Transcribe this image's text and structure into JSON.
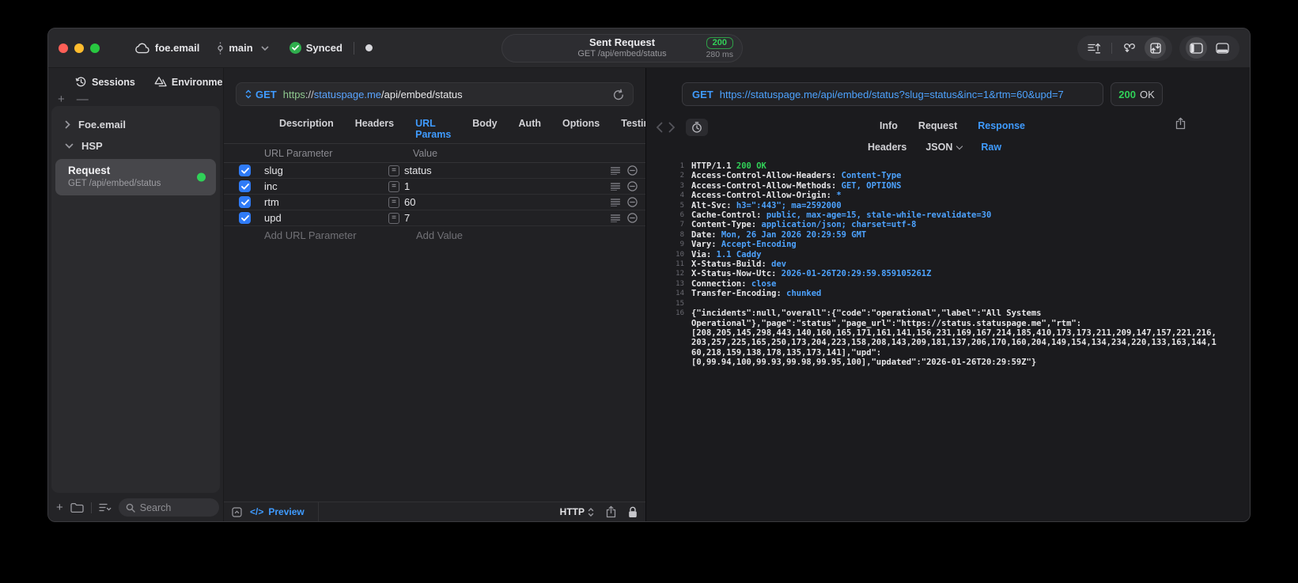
{
  "titlebar": {
    "project": "foe.email",
    "branch": "main",
    "sync_label": "Synced",
    "request_summary": {
      "title": "Sent Request",
      "subtitle": "GET /api/embed/status",
      "status_code": "200",
      "duration": "280 ms"
    }
  },
  "sidebar": {
    "tabs": [
      {
        "label": "Sessions"
      },
      {
        "label": "Environments"
      }
    ],
    "tree": {
      "group1": "Foe.email",
      "group2": "HSP"
    },
    "request_item": {
      "title": "Request",
      "subtitle": "GET /api/embed/status"
    },
    "search_placeholder": "Search"
  },
  "request_editor": {
    "method": "GET",
    "url": {
      "scheme": "https",
      "separator": "://",
      "host": "statuspage.me",
      "path": "/api/embed/status"
    },
    "tabs": [
      {
        "label": "Description",
        "active": false
      },
      {
        "label": "Headers",
        "active": false
      },
      {
        "label": "URL Params",
        "active": true
      },
      {
        "label": "Body",
        "active": false
      },
      {
        "label": "Auth",
        "active": false
      },
      {
        "label": "Options",
        "active": false
      },
      {
        "label": "Testing",
        "active": false
      }
    ],
    "params": {
      "columns": [
        "URL Parameter",
        "Value"
      ],
      "rows": [
        {
          "name": "slug",
          "value": "status",
          "enabled": true
        },
        {
          "name": "inc",
          "value": "1",
          "enabled": true
        },
        {
          "name": "rtm",
          "value": "60",
          "enabled": true
        },
        {
          "name": "upd",
          "value": "7",
          "enabled": true
        }
      ],
      "add_name": "Add URL Parameter",
      "add_value": "Add Value"
    },
    "footer": {
      "code_glyph": "</>",
      "preview": "Preview",
      "protocol": "HTTP"
    }
  },
  "response_viewer": {
    "method": "GET",
    "url": "https://statuspage.me/api/embed/status?slug=status&inc=1&rtm=60&upd=7",
    "status_code": "200",
    "status_text": "OK",
    "tabs": [
      {
        "label": "Info",
        "active": false
      },
      {
        "label": "Request",
        "active": false
      },
      {
        "label": "Response",
        "active": true
      }
    ],
    "subtabs": [
      {
        "label": "Headers",
        "active": false
      },
      {
        "label": "JSON",
        "active": false,
        "chevron": true
      },
      {
        "label": "Raw",
        "active": true
      }
    ],
    "lines": [
      {
        "n": "1",
        "segs": [
          {
            "t": "HTTP/1.1 ",
            "c": "plain"
          },
          {
            "t": "200 OK",
            "c": "green"
          }
        ]
      },
      {
        "n": "2",
        "segs": [
          {
            "t": "Access-Control-Allow-Headers:",
            "c": "key"
          },
          {
            "t": " Content-Type",
            "c": "val"
          }
        ]
      },
      {
        "n": "3",
        "segs": [
          {
            "t": "Access-Control-Allow-Methods:",
            "c": "key"
          },
          {
            "t": " GET, OPTIONS",
            "c": "val"
          }
        ]
      },
      {
        "n": "4",
        "segs": [
          {
            "t": "Access-Control-Allow-Origin:",
            "c": "key"
          },
          {
            "t": " *",
            "c": "val"
          }
        ]
      },
      {
        "n": "5",
        "segs": [
          {
            "t": "Alt-Svc:",
            "c": "key"
          },
          {
            "t": " h3=\":443\"; ma=2592000",
            "c": "val"
          }
        ]
      },
      {
        "n": "6",
        "segs": [
          {
            "t": "Cache-Control:",
            "c": "key"
          },
          {
            "t": " public, max-age=15, stale-while-revalidate=30",
            "c": "val"
          }
        ]
      },
      {
        "n": "7",
        "segs": [
          {
            "t": "Content-Type:",
            "c": "key"
          },
          {
            "t": " application/json; charset=utf-8",
            "c": "val"
          }
        ]
      },
      {
        "n": "8",
        "segs": [
          {
            "t": "Date:",
            "c": "key"
          },
          {
            "t": " Mon, 26 Jan 2026 20:29:59 GMT",
            "c": "val"
          }
        ]
      },
      {
        "n": "9",
        "segs": [
          {
            "t": "Vary:",
            "c": "key"
          },
          {
            "t": " Accept-Encoding",
            "c": "val"
          }
        ]
      },
      {
        "n": "10",
        "segs": [
          {
            "t": "Via:",
            "c": "key"
          },
          {
            "t": " 1.1 Caddy",
            "c": "val"
          }
        ]
      },
      {
        "n": "11",
        "segs": [
          {
            "t": "X-Status-Build:",
            "c": "key"
          },
          {
            "t": " dev",
            "c": "val"
          }
        ]
      },
      {
        "n": "12",
        "segs": [
          {
            "t": "X-Status-Now-Utc:",
            "c": "key"
          },
          {
            "t": " 2026-01-26T20:29:59.859105261Z",
            "c": "val"
          }
        ]
      },
      {
        "n": "13",
        "segs": [
          {
            "t": "Connection:",
            "c": "key"
          },
          {
            "t": " close",
            "c": "val"
          }
        ]
      },
      {
        "n": "14",
        "segs": [
          {
            "t": "Transfer-Encoding:",
            "c": "key"
          },
          {
            "t": " chunked",
            "c": "val"
          }
        ]
      },
      {
        "n": "15",
        "segs": []
      },
      {
        "n": "16",
        "segs": [
          {
            "t": "{\"incidents\":null,\"overall\":{\"code\":\"operational\",\"label\":\"All Systems",
            "c": "plain"
          }
        ]
      },
      {
        "n": "",
        "segs": [
          {
            "t": "Operational\"},\"page\":\"status\",\"page_url\":\"https://status.statuspage.me\",\"rtm\":",
            "c": "plain"
          }
        ]
      },
      {
        "n": "",
        "segs": [
          {
            "t": "[208,205,145,298,443,140,160,165,171,161,141,156,231,169,167,214,185,410,173,173,211,209,147,157,221,216,",
            "c": "plain"
          }
        ]
      },
      {
        "n": "",
        "segs": [
          {
            "t": "203,257,225,165,250,173,204,223,158,208,143,209,181,137,206,170,160,204,149,154,134,234,220,133,163,144,1",
            "c": "plain"
          }
        ]
      },
      {
        "n": "",
        "segs": [
          {
            "t": "60,218,159,138,178,135,173,141],\"upd\":",
            "c": "plain"
          }
        ]
      },
      {
        "n": "",
        "segs": [
          {
            "t": "[0,99.94,100,99.93,99.98,99.95,100],\"updated\":\"2026-01-26T20:29:59Z\"}",
            "c": "plain"
          }
        ]
      }
    ]
  },
  "colors": {
    "accent_blue": "#3f9bff",
    "success_green": "#30d158",
    "scheme_green": "#8fc98f",
    "checkbox_blue": "#2f7bf7",
    "traffic_red": "#ff5f57",
    "traffic_yellow": "#febc2e",
    "traffic_green": "#28c840"
  }
}
